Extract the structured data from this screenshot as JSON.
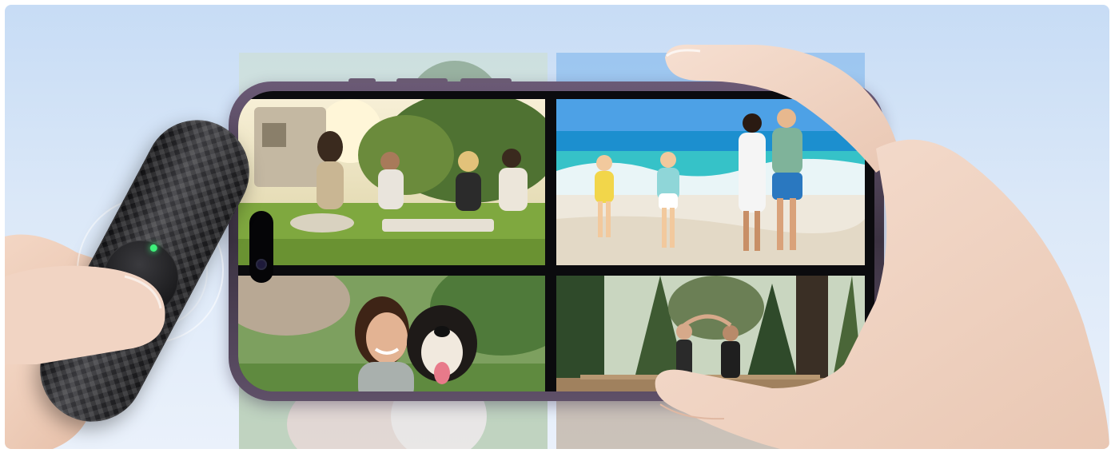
{
  "scene": {
    "description_icons": [
      "bluetooth-remote-shutter",
      "smartphone",
      "hand"
    ]
  },
  "colors": {
    "sky": "#c7dcf5",
    "phone_frame": "#4a3f52",
    "remote_body": "#1b1b1d",
    "led": "#3ef07a",
    "skin": "#f1d4c3"
  },
  "photos": [
    {
      "id": "picnic",
      "icon": "photo-group-picnic-icon"
    },
    {
      "id": "beach",
      "icon": "photo-family-beach-icon"
    },
    {
      "id": "selfie-dog",
      "icon": "photo-selfie-dog-icon"
    },
    {
      "id": "forest-couple",
      "icon": "photo-forest-couple-icon"
    }
  ]
}
